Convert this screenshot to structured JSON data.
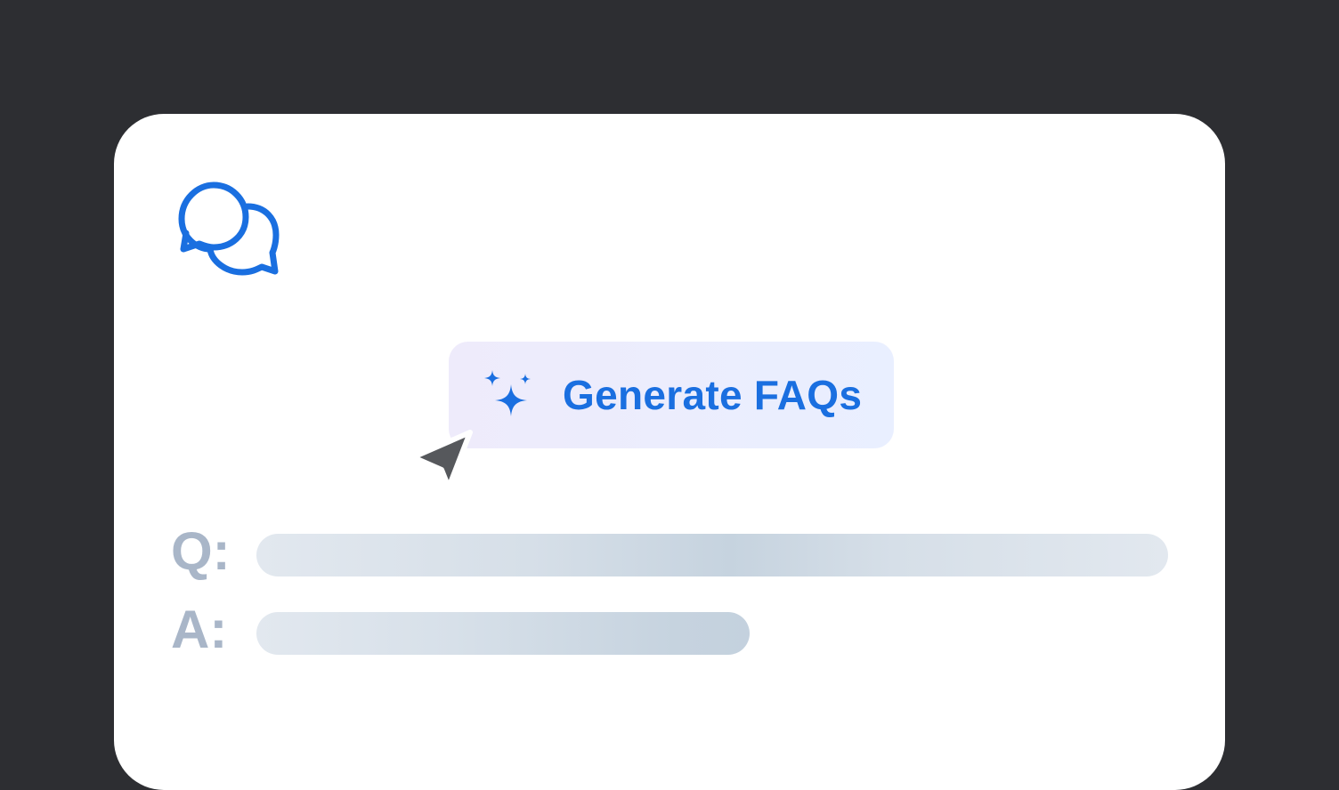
{
  "app": {
    "logo_icon": "chat-bubbles-icon",
    "accent_color": "#1a6fe0"
  },
  "generate_button": {
    "label": "Generate FAQs",
    "icon": "sparkle-icon"
  },
  "cursor": {
    "icon": "arrow-pointer-icon"
  },
  "faq": {
    "question_label": "Q:",
    "answer_label": "A:"
  }
}
